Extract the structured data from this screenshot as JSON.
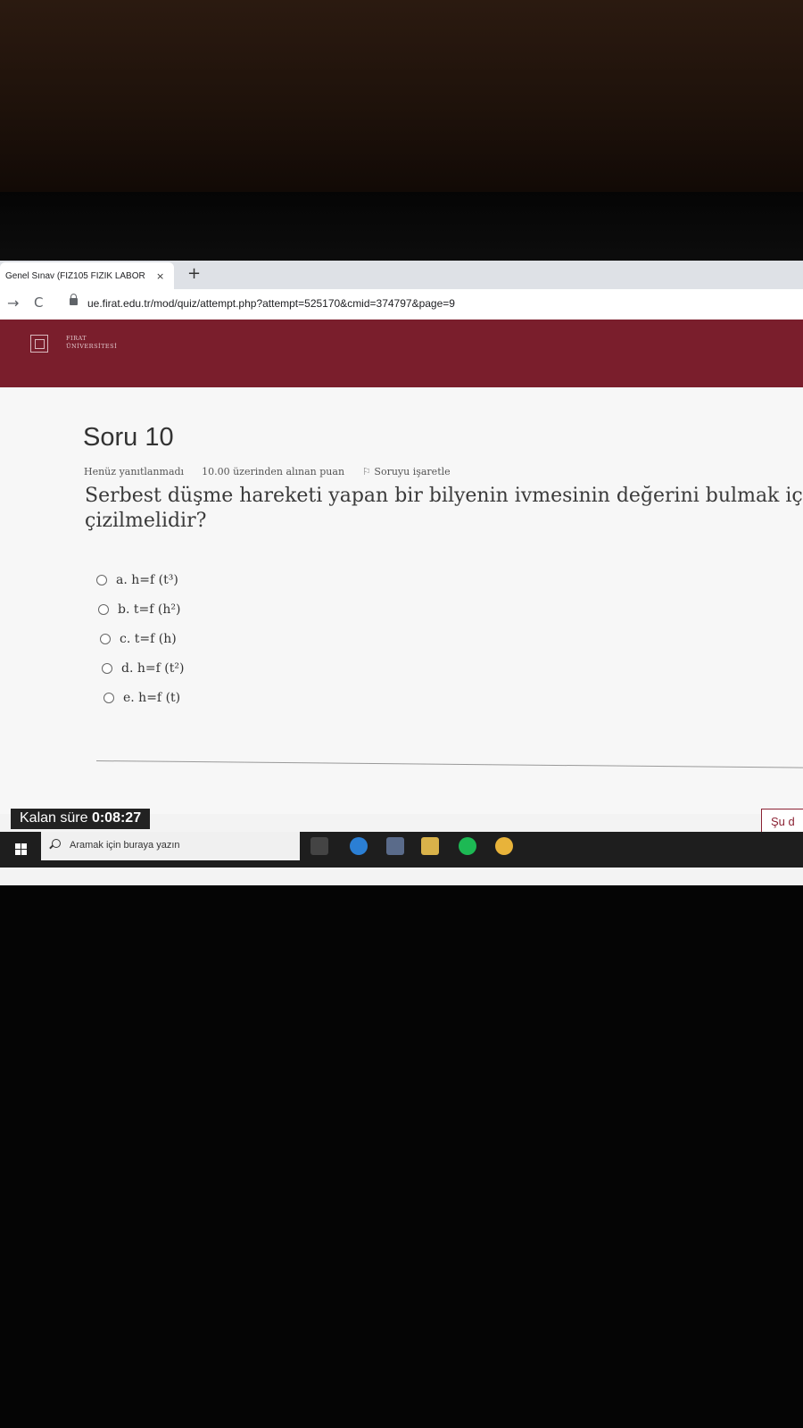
{
  "browser": {
    "tab_title": "Genel Sınav (FİZ105 FİZİK LABOR",
    "tab_close": "×",
    "new_tab": "+",
    "url": "ue.firat.edu.tr/mod/quiz/attempt.php?attempt=525170&cmid=374797&page=9"
  },
  "site": {
    "logo_line1": "FIRAT",
    "logo_line2": "ÜNİVERSİTESİ"
  },
  "question": {
    "title": "Soru 10",
    "status": "Henüz yanıtlanmadı",
    "points": "10.00 üzerinden alınan puan",
    "flag_label": "Soruyu işaretle",
    "text_line1": "Serbest düşme hareketi yapan bir bilyenin ivmesinin değerini bulmak için har",
    "text_line2": "çizilmelidir?",
    "options": [
      {
        "label": "a. h=f (t³)"
      },
      {
        "label": "b. t=f (h²)"
      },
      {
        "label": "c. t=f (h)"
      },
      {
        "label": "d. h=f (t²)"
      },
      {
        "label": "e. h=f (t)"
      }
    ]
  },
  "footer": {
    "timer_label": "Kalan süre",
    "timer_value": "0:08:27",
    "next_button": "Şu d"
  },
  "taskbar": {
    "search_placeholder": "Aramak için buraya yazın"
  }
}
